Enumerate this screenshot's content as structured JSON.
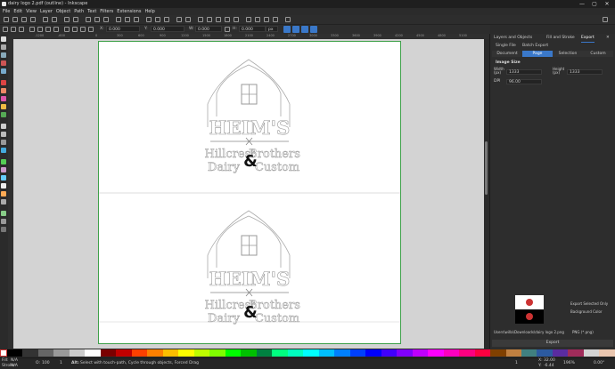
{
  "window": {
    "title": "dairy logo 2.pdf (outline) - Inkscape",
    "controls": [
      "—",
      "▢",
      "✕"
    ]
  },
  "menu": [
    "File",
    "Edit",
    "View",
    "Layer",
    "Object",
    "Path",
    "Text",
    "Filters",
    "Extensions",
    "Help"
  ],
  "toolcontrols": {
    "x_label": "X:",
    "x_value": "0.000",
    "y_label": "Y:",
    "y_value": "0.000",
    "w_label": "W:",
    "w_value": "0.000",
    "h_label": "H:",
    "h_value": "0.000",
    "unit": "px"
  },
  "ruler": {
    "marks": [
      "-1200",
      "-600",
      "0",
      "300",
      "600",
      "900",
      "1200",
      "1500",
      "1800",
      "2100",
      "2400",
      "2700",
      "3000",
      "3300",
      "3600",
      "3900",
      "4200",
      "4500",
      "4800",
      "5100",
      "5400",
      "5700"
    ]
  },
  "artwork": {
    "heims": "HEIM'S",
    "hillcrest": "Hillcrest",
    "brothers": "Brothers",
    "dairy": "Dairy",
    "custom": "Custom",
    "ampersand": "&"
  },
  "dock": {
    "tabs": [
      "Layers and Objects",
      "Fill and Stroke",
      "Export"
    ],
    "single_file": "Single File",
    "batch_export": "Batch Export",
    "subtabs": [
      "Document",
      "Page",
      "Selection",
      "Custom"
    ],
    "image_size": "Image Size",
    "width_label": "Width (px)",
    "width_value": "1333",
    "height_label": "Height (px)",
    "height_value": "1333",
    "dpi_label": "DPI",
    "dpi_value": "96.00",
    "export_selected_only": "Export Selected Only",
    "background_color": "Background Color",
    "filepath": "Users\\willa\\Downloads\\dairy logo 2.png",
    "format": "PNG (*.png)",
    "export_button": "Export"
  },
  "status": {
    "fill_label": "Fill:",
    "fill_value": "N/A",
    "stroke_label": "Stroke:",
    "stroke_value": "N/A",
    "opacity_label": "O:",
    "opacity_value": "100",
    "layer_value": "1",
    "message_key": "Alt:",
    "message": "Select with touch-path, Cycle through objects, Forced Drag",
    "x_label": "X:",
    "x_value": "32.00",
    "y_label": "Y:",
    "y_value": "-6.44",
    "zoom": "196%",
    "rotation": "0.00°",
    "page_value": "1"
  }
}
